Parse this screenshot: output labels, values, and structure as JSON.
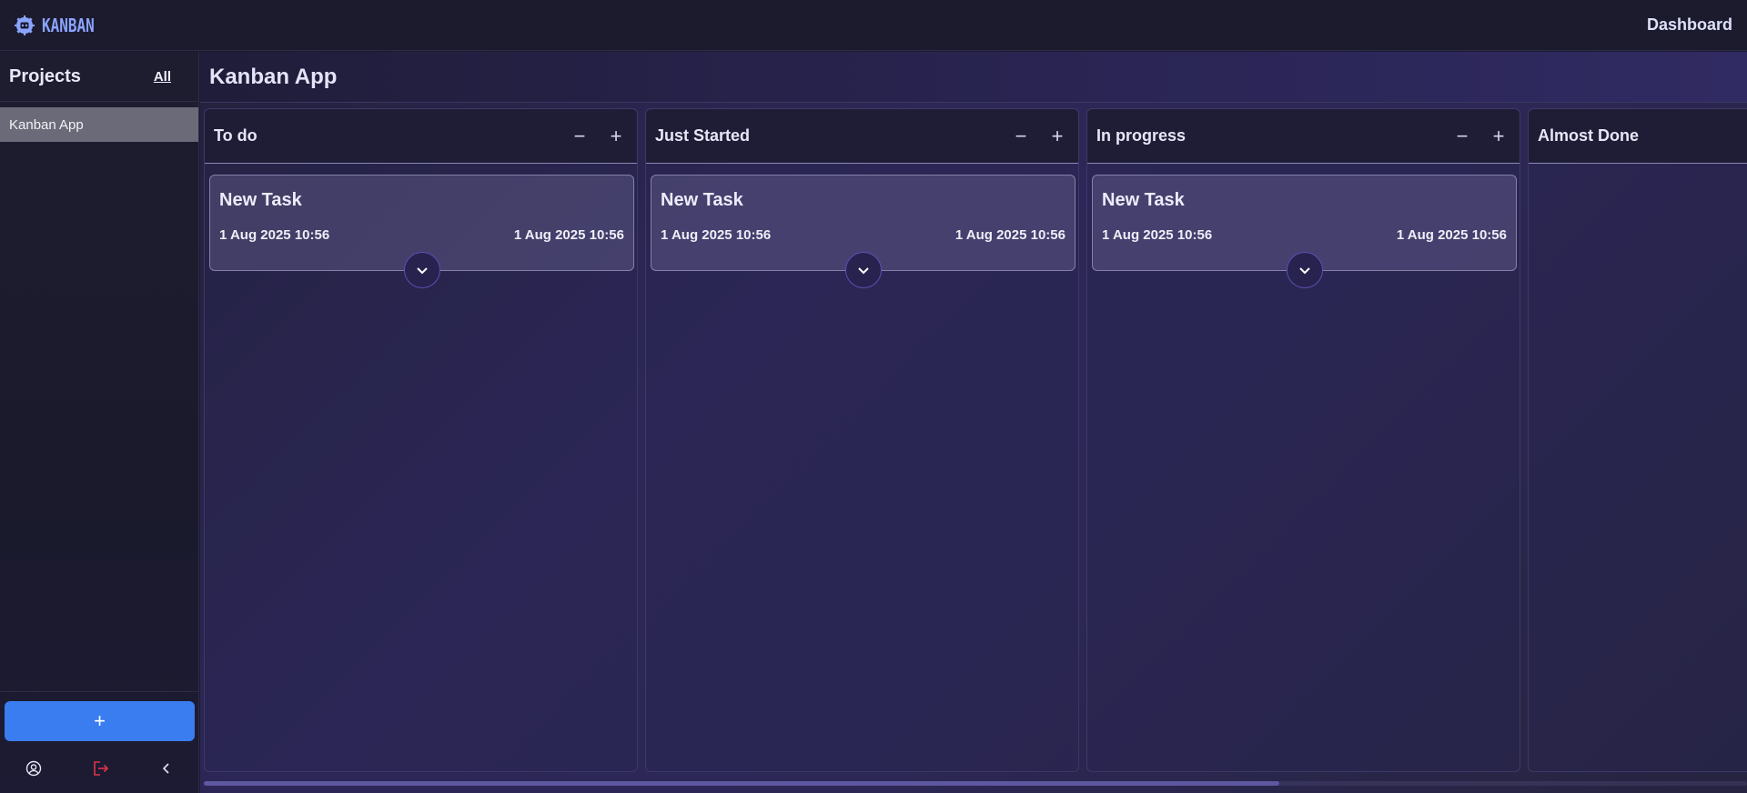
{
  "app": {
    "logo_text": "KANBAN",
    "logo_icon": "gear-robot-icon",
    "nav_dashboard": "Dashboard"
  },
  "sidebar": {
    "title": "Projects",
    "all_link": "All",
    "projects": [
      {
        "label": "Kanban App",
        "selected": true
      }
    ],
    "add_button_label": "+",
    "footer_icons": [
      "user-icon",
      "logout-icon",
      "collapse-chevron-icon"
    ]
  },
  "board": {
    "title": "Kanban App",
    "columns": [
      {
        "title": "To do",
        "minus": "−",
        "plus": "+",
        "tasks": [
          {
            "title": "New Task",
            "created": "1 Aug 2025 10:56",
            "updated": "1 Aug 2025 10:56"
          }
        ]
      },
      {
        "title": "Just Started",
        "minus": "−",
        "plus": "+",
        "tasks": [
          {
            "title": "New Task",
            "created": "1 Aug 2025 10:56",
            "updated": "1 Aug 2025 10:56"
          }
        ]
      },
      {
        "title": "In progress",
        "minus": "−",
        "plus": "+",
        "tasks": [
          {
            "title": "New Task",
            "created": "1 Aug 2025 10:56",
            "updated": "1 Aug 2025 10:56"
          }
        ]
      },
      {
        "title": "Almost Done",
        "tasks": []
      }
    ]
  },
  "colors": {
    "accent_blue": "#3a7df0",
    "logo_blue": "#8aa4ff",
    "logout_red": "#e0344a"
  }
}
